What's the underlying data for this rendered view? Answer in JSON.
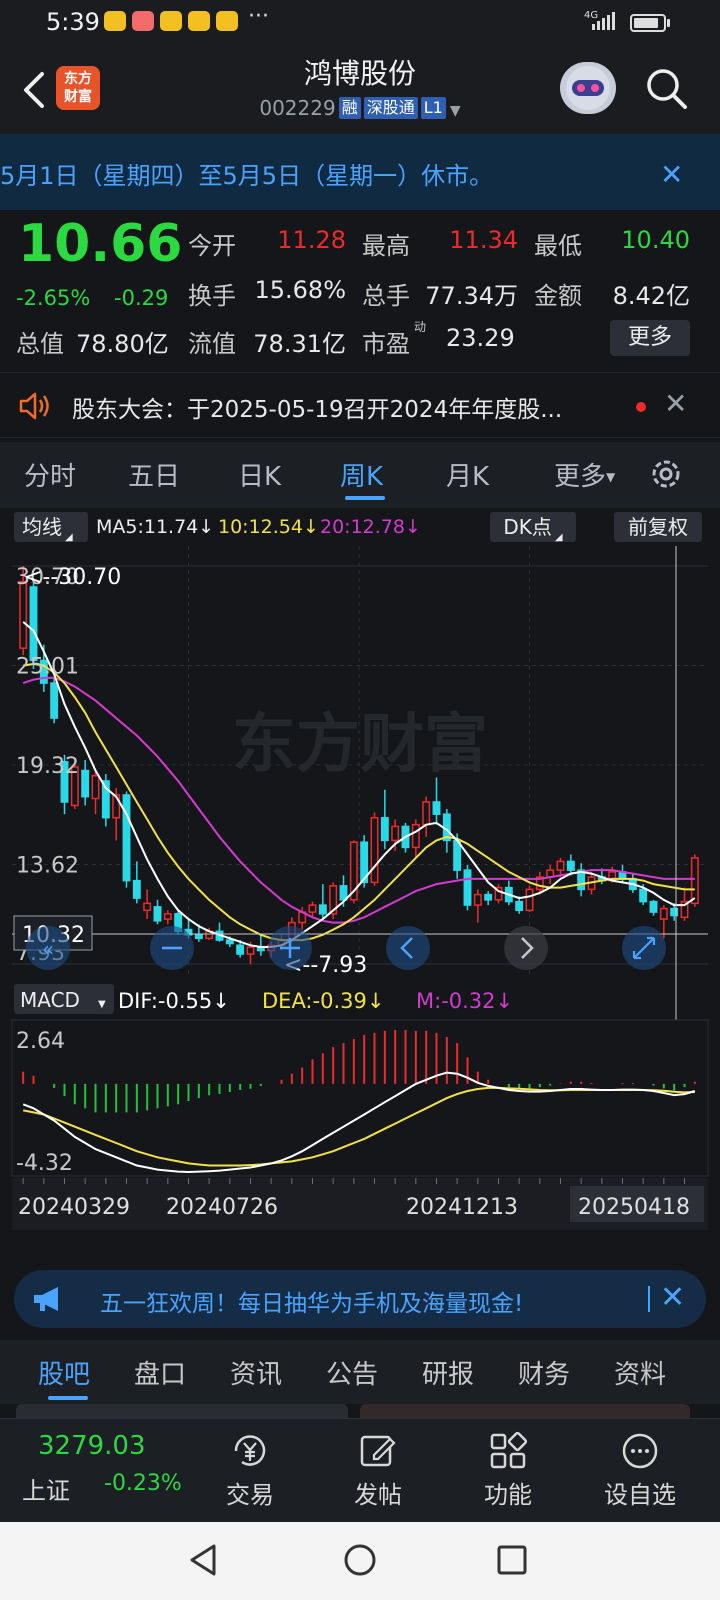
{
  "status_bar": {
    "time": "5:39",
    "dots": "···",
    "network": "4G"
  },
  "header": {
    "app_logo_text": "东方\n财富",
    "stock_name": "鸿博股份",
    "stock_code": "002229",
    "tags": [
      "融",
      "深股通",
      "L1"
    ]
  },
  "notice": {
    "text": "5月1日（星期四）至5月5日（星期一）休市。"
  },
  "quote": {
    "last_price": "10.66",
    "pct_change": "-2.65%",
    "abs_change": "-0.29",
    "fields": [
      {
        "label": "今开",
        "value": "11.28",
        "color": "#f02a2a"
      },
      {
        "label": "最高",
        "value": "11.34",
        "color": "#f02a2a"
      },
      {
        "label": "最低",
        "value": "10.40",
        "color": "#2bd940"
      },
      {
        "label": "换手",
        "value": "15.68%",
        "color": "#e8e8e8"
      },
      {
        "label": "总手",
        "value": "77.34万",
        "color": "#e8e8e8"
      },
      {
        "label": "金额",
        "value": "8.42亿",
        "color": "#e8e8e8"
      },
      {
        "label": "总值",
        "value": "78.80亿",
        "color": "#e8e8e8"
      },
      {
        "label": "流值",
        "value": "78.31亿",
        "color": "#e8e8e8"
      },
      {
        "label": "市盈",
        "value": "23.29",
        "color": "#e8e8e8"
      }
    ],
    "pe_superscript": "动",
    "more_label": "更多"
  },
  "meeting": {
    "text": "股东大会：于2025-05-19召开2024年年度股..."
  },
  "period_tabs": [
    "分时",
    "五日",
    "日K",
    "周K",
    "月K",
    "更多"
  ],
  "active_period": "周K",
  "indicators": {
    "ma_select": "均线",
    "ma5": "MA5:11.74↓",
    "ma10": "10:12.54↓",
    "ma20": "20:12.78↓",
    "dk_label": "DK点",
    "fq_label": "前复权",
    "macd_select": "MACD",
    "dif": "DIF:-0.55↓",
    "dea": "DEA:-0.39↓",
    "m": "M:-0.32↓"
  },
  "chart_data": {
    "type": "candlestick",
    "price_axis_labels": [
      "30.70",
      "25.01",
      "19.32",
      "13.62",
      "7.93"
    ],
    "high_marker": "<--30.70",
    "low_marker": "<--7.93",
    "crosshair_price": "10.32",
    "ylim": [
      7.93,
      30.7
    ],
    "macd_axis_labels": [
      "2.64",
      "-4.32"
    ],
    "macd_ylim": [
      -4.32,
      2.64
    ],
    "date_labels": [
      "20240329",
      "20240726",
      "20241213",
      "20250418"
    ],
    "watermark": "东方财富",
    "colors": {
      "up": "#f02a2a",
      "down": "#2ad9e8",
      "ma5": "#ffffff",
      "ma10": "#f2e24a",
      "ma20": "#d33bd0",
      "macd_up": "#f02a2a",
      "macd_down": "#22c33c"
    },
    "candles": [
      {
        "o": 26.0,
        "h": 30.7,
        "l": 25.6,
        "c": 29.8
      },
      {
        "o": 29.5,
        "h": 29.9,
        "l": 24.8,
        "c": 25.3
      },
      {
        "o": 25.3,
        "h": 26.2,
        "l": 23.5,
        "c": 24.0
      },
      {
        "o": 24.0,
        "h": 24.3,
        "l": 21.7,
        "c": 22.0
      },
      {
        "o": 19.5,
        "h": 19.9,
        "l": 16.5,
        "c": 17.2
      },
      {
        "o": 17.0,
        "h": 19.6,
        "l": 16.8,
        "c": 19.2
      },
      {
        "o": 19.0,
        "h": 19.6,
        "l": 17.0,
        "c": 17.5
      },
      {
        "o": 17.4,
        "h": 19.0,
        "l": 16.5,
        "c": 18.7
      },
      {
        "o": 18.4,
        "h": 18.8,
        "l": 15.8,
        "c": 16.3
      },
      {
        "o": 16.3,
        "h": 18.0,
        "l": 15.0,
        "c": 17.6
      },
      {
        "o": 17.6,
        "h": 17.8,
        "l": 12.3,
        "c": 12.7
      },
      {
        "o": 12.7,
        "h": 13.8,
        "l": 11.4,
        "c": 11.7
      },
      {
        "o": 11.0,
        "h": 12.2,
        "l": 10.5,
        "c": 11.4
      },
      {
        "o": 11.2,
        "h": 11.6,
        "l": 10.2,
        "c": 10.4
      },
      {
        "o": 10.5,
        "h": 11.0,
        "l": 10.2,
        "c": 10.8
      },
      {
        "o": 10.8,
        "h": 11.0,
        "l": 9.6,
        "c": 9.8
      },
      {
        "o": 9.9,
        "h": 10.5,
        "l": 9.4,
        "c": 9.6
      },
      {
        "o": 9.6,
        "h": 10.2,
        "l": 9.2,
        "c": 9.4
      },
      {
        "o": 9.4,
        "h": 10.0,
        "l": 9.3,
        "c": 9.8
      },
      {
        "o": 9.8,
        "h": 10.3,
        "l": 9.2,
        "c": 9.3
      },
      {
        "o": 9.3,
        "h": 9.5,
        "l": 8.9,
        "c": 9.1
      },
      {
        "o": 9.0,
        "h": 9.3,
        "l": 8.3,
        "c": 8.5
      },
      {
        "o": 8.5,
        "h": 9.2,
        "l": 7.93,
        "c": 8.9
      },
      {
        "o": 8.9,
        "h": 9.6,
        "l": 8.4,
        "c": 8.7
      },
      {
        "o": 8.7,
        "h": 9.2,
        "l": 8.3,
        "c": 9.0
      },
      {
        "o": 9.0,
        "h": 9.6,
        "l": 8.7,
        "c": 9.3
      },
      {
        "o": 9.3,
        "h": 10.6,
        "l": 9.2,
        "c": 10.3
      },
      {
        "o": 10.3,
        "h": 11.2,
        "l": 9.9,
        "c": 10.9
      },
      {
        "o": 10.9,
        "h": 11.5,
        "l": 10.6,
        "c": 11.3
      },
      {
        "o": 11.3,
        "h": 12.5,
        "l": 10.5,
        "c": 10.8
      },
      {
        "o": 10.8,
        "h": 12.6,
        "l": 10.5,
        "c": 12.4
      },
      {
        "o": 12.4,
        "h": 13.0,
        "l": 11.2,
        "c": 11.6
      },
      {
        "o": 11.6,
        "h": 15.0,
        "l": 11.4,
        "c": 14.9
      },
      {
        "o": 14.9,
        "h": 15.3,
        "l": 12.3,
        "c": 12.6
      },
      {
        "o": 12.6,
        "h": 16.6,
        "l": 12.4,
        "c": 16.3
      },
      {
        "o": 16.3,
        "h": 17.9,
        "l": 14.5,
        "c": 15.0
      },
      {
        "o": 15.0,
        "h": 16.2,
        "l": 14.4,
        "c": 15.8
      },
      {
        "o": 15.8,
        "h": 16.0,
        "l": 14.3,
        "c": 14.6
      },
      {
        "o": 14.6,
        "h": 16.2,
        "l": 14.0,
        "c": 15.9
      },
      {
        "o": 15.9,
        "h": 17.5,
        "l": 15.2,
        "c": 17.2
      },
      {
        "o": 17.2,
        "h": 18.6,
        "l": 15.9,
        "c": 16.5
      },
      {
        "o": 16.5,
        "h": 16.8,
        "l": 14.3,
        "c": 15.0
      },
      {
        "o": 15.0,
        "h": 15.4,
        "l": 12.8,
        "c": 13.3
      },
      {
        "o": 13.3,
        "h": 13.6,
        "l": 11.0,
        "c": 11.3
      },
      {
        "o": 11.3,
        "h": 12.2,
        "l": 10.3,
        "c": 11.9
      },
      {
        "o": 11.9,
        "h": 12.1,
        "l": 11.3,
        "c": 11.6
      },
      {
        "o": 11.6,
        "h": 12.5,
        "l": 11.4,
        "c": 12.3
      },
      {
        "o": 12.3,
        "h": 12.7,
        "l": 11.3,
        "c": 11.5
      },
      {
        "o": 11.5,
        "h": 11.8,
        "l": 10.8,
        "c": 11.0
      },
      {
        "o": 11.0,
        "h": 12.4,
        "l": 10.9,
        "c": 12.2
      },
      {
        "o": 12.2,
        "h": 13.2,
        "l": 11.9,
        "c": 12.9
      },
      {
        "o": 12.9,
        "h": 13.6,
        "l": 12.5,
        "c": 13.3
      },
      {
        "o": 13.3,
        "h": 14.0,
        "l": 12.9,
        "c": 13.8
      },
      {
        "o": 13.8,
        "h": 14.2,
        "l": 13.0,
        "c": 13.3
      },
      {
        "o": 13.3,
        "h": 13.7,
        "l": 11.8,
        "c": 12.2
      },
      {
        "o": 12.2,
        "h": 13.2,
        "l": 11.9,
        "c": 12.9
      },
      {
        "o": 12.9,
        "h": 13.4,
        "l": 12.5,
        "c": 12.7
      },
      {
        "o": 12.7,
        "h": 13.5,
        "l": 12.6,
        "c": 13.2
      },
      {
        "o": 13.2,
        "h": 13.6,
        "l": 12.6,
        "c": 12.8
      },
      {
        "o": 12.8,
        "h": 13.1,
        "l": 12.0,
        "c": 12.2
      },
      {
        "o": 12.2,
        "h": 12.5,
        "l": 11.3,
        "c": 11.5
      },
      {
        "o": 11.5,
        "h": 11.6,
        "l": 10.7,
        "c": 10.9
      },
      {
        "o": 10.5,
        "h": 11.3,
        "l": 9.4,
        "c": 11.1
      },
      {
        "o": 11.1,
        "h": 11.4,
        "l": 10.4,
        "c": 10.7
      },
      {
        "o": 10.6,
        "h": 12.3,
        "l": 10.4,
        "c": 11.5
      },
      {
        "o": 11.4,
        "h": 14.2,
        "l": 11.2,
        "c": 14.0
      }
    ],
    "ma5": [
      27.5,
      27.0,
      25.8,
      24.5,
      22.8,
      21.5,
      20.3,
      19.0,
      18.0,
      17.5,
      16.5,
      15.2,
      13.9,
      12.8,
      11.8,
      11.0,
      10.5,
      10.1,
      9.8,
      9.6,
      9.4,
      9.2,
      9.0,
      8.9,
      8.9,
      9.0,
      9.3,
      9.7,
      10.1,
      10.5,
      11.0,
      11.5,
      12.1,
      12.8,
      13.5,
      14.2,
      14.8,
      15.2,
      15.5,
      15.9,
      16.0,
      15.6,
      15.0,
      14.2,
      13.4,
      12.6,
      12.1,
      11.9,
      11.7,
      11.8,
      12.0,
      12.3,
      12.8,
      13.1,
      13.2,
      13.1,
      12.9,
      12.7,
      12.6,
      12.5,
      12.3,
      12.0,
      11.6,
      11.3,
      11.3,
      11.7
    ],
    "ma10": [
      25.0,
      25.1,
      25.0,
      24.6,
      24.0,
      23.2,
      22.3,
      21.2,
      20.2,
      19.2,
      18.2,
      17.2,
      16.2,
      15.2,
      14.3,
      13.5,
      12.8,
      12.2,
      11.6,
      11.1,
      10.6,
      10.2,
      9.9,
      9.6,
      9.4,
      9.3,
      9.3,
      9.3,
      9.4,
      9.6,
      9.9,
      10.2,
      10.6,
      11.1,
      11.6,
      12.2,
      12.8,
      13.4,
      14.0,
      14.6,
      15.0,
      15.2,
      15.1,
      14.8,
      14.4,
      14.0,
      13.6,
      13.2,
      12.9,
      12.6,
      12.4,
      12.3,
      12.3,
      12.4,
      12.5,
      12.6,
      12.7,
      12.8,
      12.8,
      12.8,
      12.7,
      12.5,
      12.4,
      12.3,
      12.2,
      12.2
    ],
    "ma20": [
      24.0,
      24.2,
      24.3,
      24.3,
      24.1,
      23.8,
      23.4,
      23.0,
      22.5,
      22.0,
      21.5,
      21.0,
      20.4,
      19.8,
      19.1,
      18.4,
      17.6,
      16.8,
      16.0,
      15.2,
      14.5,
      13.8,
      13.2,
      12.6,
      12.1,
      11.6,
      11.2,
      10.9,
      10.6,
      10.4,
      10.3,
      10.3,
      10.4,
      10.6,
      10.9,
      11.2,
      11.5,
      11.8,
      12.1,
      12.3,
      12.5,
      12.6,
      12.7,
      12.8,
      12.8,
      12.8,
      12.8,
      12.8,
      12.8,
      12.8,
      12.8,
      12.9,
      13.0,
      13.1,
      13.2,
      13.3,
      13.3,
      13.3,
      13.2,
      13.1,
      13.0,
      12.9,
      12.8,
      12.8,
      12.8,
      12.8
    ],
    "dif": [
      -1.0,
      -1.2,
      -1.5,
      -1.8,
      -2.2,
      -2.6,
      -2.9,
      -3.2,
      -3.4,
      -3.6,
      -3.8,
      -4.0,
      -4.1,
      -4.2,
      -4.25,
      -4.3,
      -4.32,
      -4.3,
      -4.28,
      -4.25,
      -4.2,
      -4.15,
      -4.1,
      -4.0,
      -3.9,
      -3.75,
      -3.55,
      -3.3,
      -3.0,
      -2.7,
      -2.4,
      -2.1,
      -1.8,
      -1.5,
      -1.2,
      -0.9,
      -0.6,
      -0.3,
      0.0,
      0.2,
      0.4,
      0.55,
      0.5,
      0.3,
      0.05,
      -0.1,
      -0.2,
      -0.3,
      -0.35,
      -0.38,
      -0.38,
      -0.35,
      -0.3,
      -0.25,
      -0.25,
      -0.28,
      -0.3,
      -0.3,
      -0.28,
      -0.28,
      -0.3,
      -0.35,
      -0.45,
      -0.55,
      -0.5,
      -0.35
    ],
    "dea": [
      -1.3,
      -1.4,
      -1.5,
      -1.7,
      -1.9,
      -2.1,
      -2.3,
      -2.5,
      -2.7,
      -2.9,
      -3.1,
      -3.3,
      -3.45,
      -3.6,
      -3.7,
      -3.8,
      -3.9,
      -3.95,
      -4.0,
      -4.0,
      -4.0,
      -4.0,
      -3.98,
      -3.95,
      -3.9,
      -3.85,
      -3.8,
      -3.7,
      -3.6,
      -3.45,
      -3.3,
      -3.1,
      -2.9,
      -2.7,
      -2.45,
      -2.2,
      -1.95,
      -1.7,
      -1.45,
      -1.2,
      -0.95,
      -0.7,
      -0.5,
      -0.35,
      -0.25,
      -0.2,
      -0.2,
      -0.22,
      -0.24,
      -0.27,
      -0.3,
      -0.31,
      -0.31,
      -0.3,
      -0.3,
      -0.3,
      -0.3,
      -0.3,
      -0.3,
      -0.3,
      -0.3,
      -0.31,
      -0.34,
      -0.39,
      -0.42,
      -0.4
    ],
    "macd": [
      0.6,
      0.4,
      0.0,
      -0.2,
      -0.6,
      -1.0,
      -1.2,
      -1.4,
      -1.4,
      -1.4,
      -1.4,
      -1.4,
      -1.3,
      -1.2,
      -1.1,
      -1.0,
      -0.84,
      -0.7,
      -0.56,
      -0.5,
      -0.4,
      -0.3,
      -0.24,
      -0.1,
      0.0,
      0.2,
      0.5,
      0.8,
      1.2,
      1.5,
      1.8,
      2.0,
      2.2,
      2.4,
      2.5,
      2.6,
      2.64,
      2.64,
      2.6,
      2.6,
      2.5,
      2.3,
      2.0,
      1.3,
      0.6,
      0.2,
      0.0,
      -0.16,
      -0.22,
      -0.22,
      -0.16,
      -0.08,
      0.02,
      0.1,
      0.1,
      0.04,
      0.0,
      0.0,
      0.04,
      0.04,
      0.0,
      -0.08,
      -0.22,
      -0.32,
      -0.16,
      0.1
    ]
  },
  "promo": {
    "text": "五一狂欢周！每日抽华为手机及海量现金!"
  },
  "section_tabs": [
    "股吧",
    "盘口",
    "资讯",
    "公告",
    "研报",
    "财务",
    "资料"
  ],
  "active_section": "股吧",
  "bottom_nav": {
    "index_value": "3279.03",
    "index_name": "上证",
    "index_change": "-0.23%",
    "items": [
      {
        "label": "交易",
        "icon": "trade-yen-icon"
      },
      {
        "label": "发帖",
        "icon": "compose-icon"
      },
      {
        "label": "功能",
        "icon": "grid-icon"
      },
      {
        "label": "设自选",
        "icon": "more-circle-icon"
      }
    ]
  }
}
